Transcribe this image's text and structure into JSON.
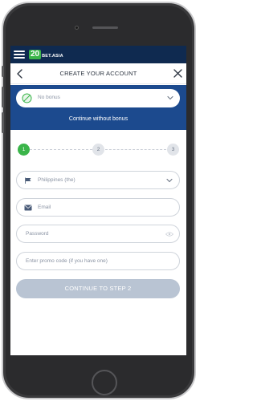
{
  "brand": {
    "logo_number": "20",
    "logo_text": "BET.ASIA",
    "badge_color": "#3bb54a",
    "topbar_color": "#0f2a50"
  },
  "header": {
    "title": "CREATE YOUR ACCOUNT"
  },
  "bonus": {
    "selected": "No bonus",
    "continue_label": "Continue without bonus",
    "panel_color": "#1c4a8e"
  },
  "steps": [
    {
      "label": "1",
      "state": "active"
    },
    {
      "label": "2",
      "state": "inactive"
    },
    {
      "label": "3",
      "state": "inactive"
    }
  ],
  "form": {
    "country": {
      "value": "Philippines (the)",
      "icon": "flag-icon"
    },
    "email": {
      "placeholder": "Email",
      "icon": "envelope-icon"
    },
    "password": {
      "placeholder": "Password",
      "icon": "eye-icon"
    },
    "promo": {
      "placeholder": "Enter promo code (if you have one)"
    }
  },
  "cta": {
    "label": "CONTINUE TO STEP 2",
    "state": "disabled"
  }
}
